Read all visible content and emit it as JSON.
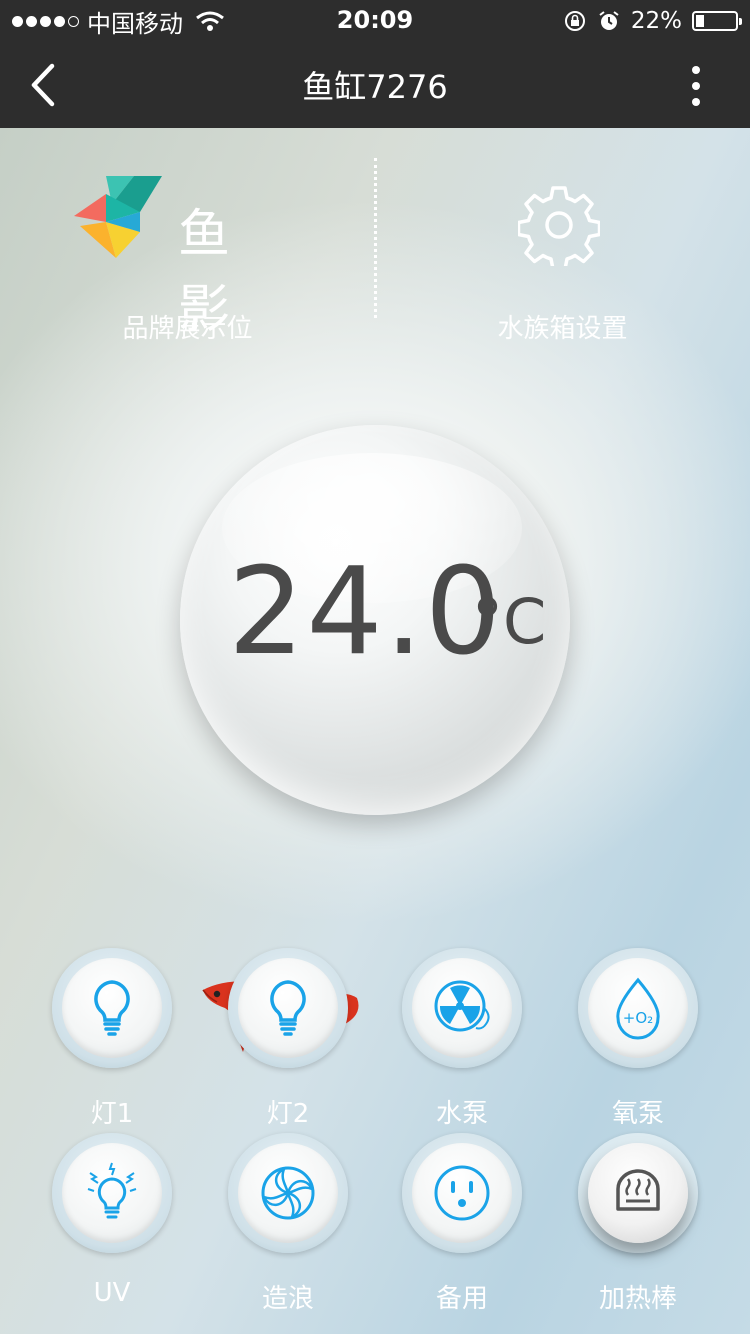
{
  "status_bar": {
    "carrier": "中国移动",
    "time": "20:09",
    "battery": "22%",
    "battery_level": 0.22
  },
  "nav": {
    "title": "鱼缸7276"
  },
  "brand": {
    "wordmark": "鱼 影",
    "label": "品牌展示位"
  },
  "settings": {
    "label": "水族箱设置"
  },
  "temperature": {
    "value": "24.0",
    "unit": "°C"
  },
  "controls": [
    {
      "label": "灯1",
      "icon": "bulb-icon",
      "state": "on"
    },
    {
      "label": "灯2",
      "icon": "bulb-icon",
      "state": "on"
    },
    {
      "label": "水泵",
      "icon": "pump-fan-icon",
      "state": "on"
    },
    {
      "label": "氧泵",
      "icon": "oxygen-drop-icon",
      "icon_text": "+O₂",
      "state": "on"
    },
    {
      "label": "UV",
      "icon": "uv-bulb-icon",
      "state": "on"
    },
    {
      "label": "造浪",
      "icon": "wave-maker-icon",
      "state": "on"
    },
    {
      "label": "备用",
      "icon": "socket-icon",
      "state": "on"
    },
    {
      "label": "加热棒",
      "icon": "heater-icon",
      "state": "off"
    }
  ],
  "colors": {
    "active_icon": "#1aa3e8",
    "inactive_icon": "#555555",
    "nav_bg": "#2d2d2d",
    "fish": "#d9331e"
  }
}
